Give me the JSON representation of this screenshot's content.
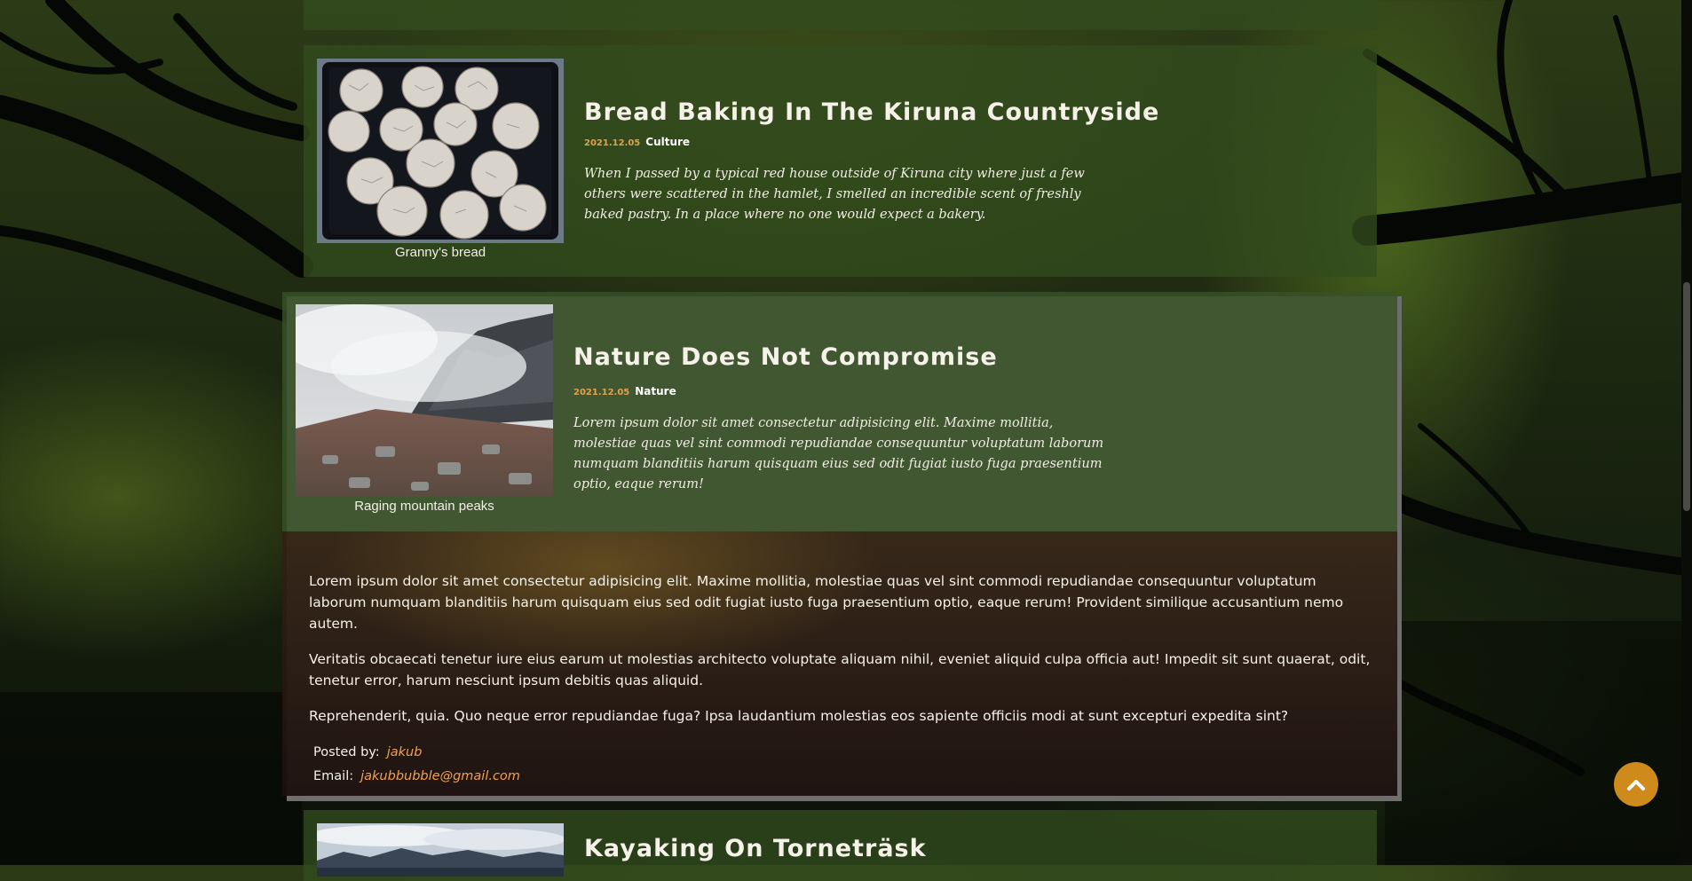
{
  "posts": [
    {
      "title": "Bread Baking In The Kiruna Countryside",
      "date": "2021.12.05",
      "category": "Culture",
      "caption": "Granny's bread",
      "excerpt": "When I passed by a typical red house outside of Kiruna city where just a few others were scattered in the hamlet, I smelled an incredible scent of freshly baked pastry. In a place where no one would expect a bakery."
    },
    {
      "title": "Nature Does Not Compromise",
      "date": "2021.12.05",
      "category": "Nature",
      "caption": "Raging mountain peaks",
      "excerpt": "Lorem ipsum dolor sit amet consectetur adipisicing elit. Maxime mollitia, molestiae quas vel sint commodi repudiandae consequuntur voluptatum laborum numquam blanditiis harum quisquam eius sed odit fugiat iusto fuga praesentium optio, eaque rerum!",
      "body": [
        "Lorem ipsum dolor sit amet consectetur adipisicing elit. Maxime mollitia, molestiae quas vel sint commodi repudiandae consequuntur voluptatum laborum numquam blanditiis harum quisquam eius sed odit fugiat iusto fuga praesentium optio, eaque rerum! Provident similique accusantium nemo autem.",
        "Veritatis obcaecati tenetur iure eius earum ut molestias architecto voluptate aliquam nihil, eveniet aliquid culpa officia aut! Impedit sit sunt quaerat, odit, tenetur error, harum nesciunt ipsum debitis quas aliquid.",
        "Reprehenderit, quia. Quo neque error repudiandae fuga? Ipsa laudantium molestias eos sapiente officiis modi at sunt excepturi expedita sint?"
      ],
      "posted_by_label": "Posted by:",
      "author": "jakub",
      "email_label": "Email:",
      "email": "jakubbubble@gmail.com"
    },
    {
      "title": "Kayaking On Torneträsk"
    }
  ],
  "back_to_top": {
    "icon": "chevron-up-icon"
  },
  "colors": {
    "card": "#324b1e",
    "date_accent": "#e3a14b",
    "link_accent": "#f0a052",
    "back_to_top": "#cf8a1c"
  }
}
